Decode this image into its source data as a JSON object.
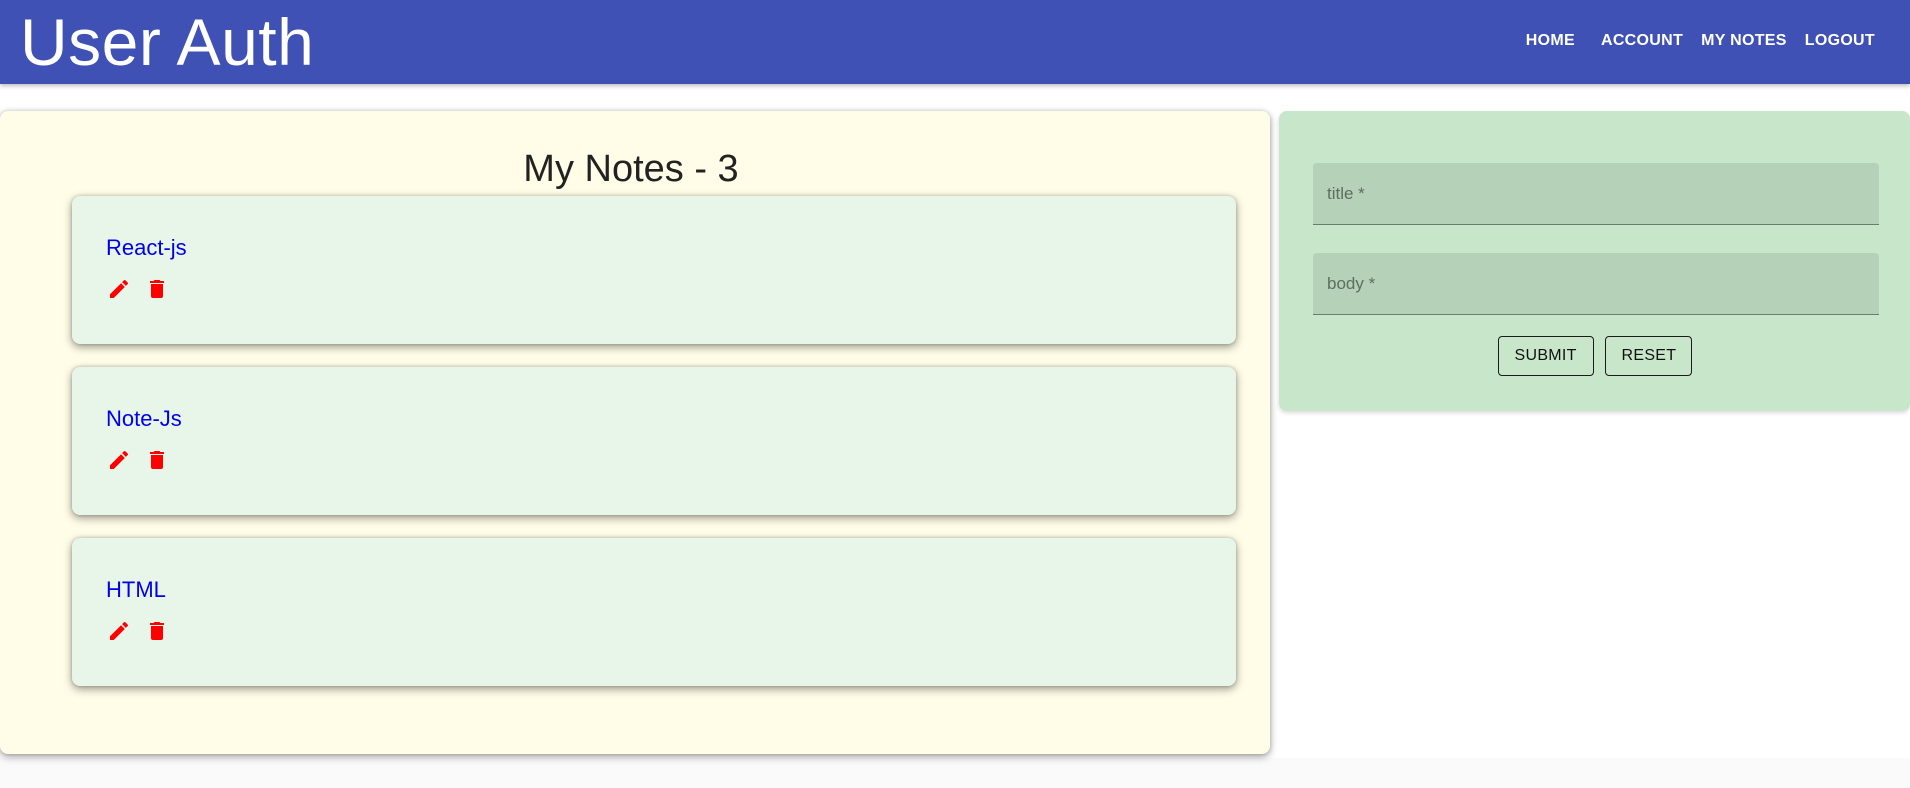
{
  "app": {
    "title": "User Auth",
    "brand_color": "#3f51b5"
  },
  "nav": {
    "items": [
      {
        "label": "HOME"
      },
      {
        "label": "ACCOUNT"
      },
      {
        "label": "MY NOTES"
      },
      {
        "label": "LOGOUT"
      }
    ]
  },
  "notes": {
    "heading": "My Notes - 3",
    "panel_color": "#fffde7",
    "card_color": "#e8f5e9",
    "title_color": "#0000ee",
    "icon_color": "#ff0000",
    "items": [
      {
        "title": "React-js",
        "edit_icon": "edit-icon",
        "delete_icon": "delete-icon"
      },
      {
        "title": "Note-Js",
        "edit_icon": "edit-icon",
        "delete_icon": "delete-icon"
      },
      {
        "title": "HTML",
        "edit_icon": "edit-icon",
        "delete_icon": "delete-icon"
      }
    ]
  },
  "form": {
    "panel_color": "#c8e6c9",
    "title_field": {
      "placeholder": "title *",
      "value": ""
    },
    "body_field": {
      "placeholder": "body *",
      "value": ""
    },
    "submit_label": "SUBMIT",
    "reset_label": "RESET"
  }
}
